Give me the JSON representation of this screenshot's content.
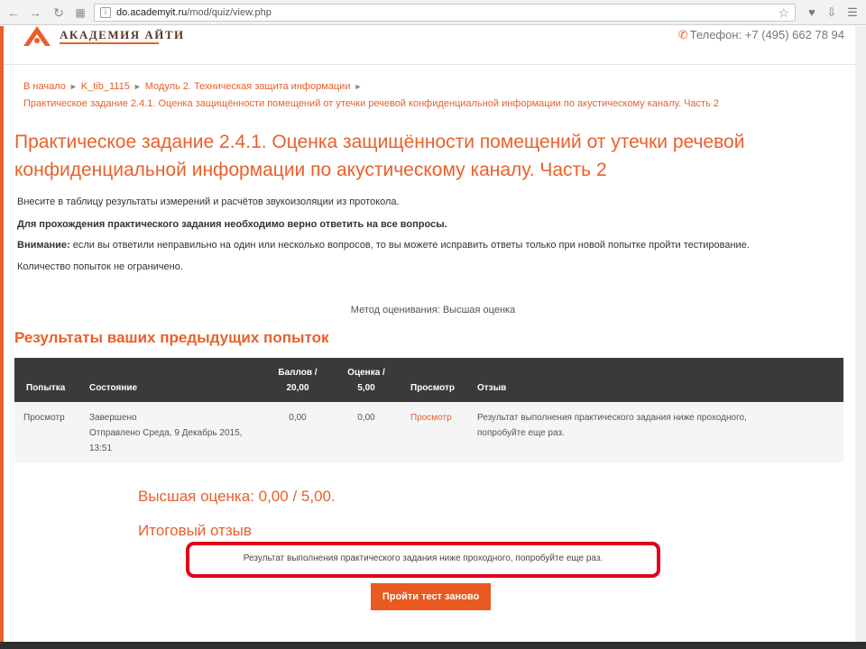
{
  "browser": {
    "url_host": "do.academyit.ru",
    "url_path": "/mod/quiz/view.php",
    "icons": [
      "back-icon",
      "forward-icon",
      "reload-icon",
      "apps-icon",
      "lock-icon",
      "star-icon",
      "heart-icon",
      "download-icon",
      "menu-icon"
    ]
  },
  "header": {
    "logo_text": "АКАДЕМИЯ АЙТИ",
    "phone": "Телефон: +7 (495) 662 78 94",
    "accent": "#e8602c"
  },
  "breadcrumb": {
    "items": [
      "В начало",
      "K_tib_1115",
      "Модуль 2. Техническая защита информации"
    ],
    "current": "Практическое задание 2.4.1. Оценка защищённости помещений от утечки речевой конфиденциальной информации по акустическому каналу. Часть 2"
  },
  "page": {
    "title": "Практическое задание 2.4.1. Оценка защищённости помещений от утечки речевой конфиденциальной информации по акустическому каналу. Часть 2",
    "intro_1": "Внесите в таблицу результаты измерений и расчётов звукоизоляции из протокола.",
    "intro_2": "Для прохождения практического задания необходимо верно ответить на все вопросы.",
    "intro_3_label": "Внимание:",
    "intro_3_text": " если вы ответили неправильно на один или несколько вопросов, то вы можете исправить ответы только при новой попытке пройти тестирование.",
    "intro_4": "Количество попыток не ограничено.",
    "grading_method": "Метод оценивания: Высшая оценка"
  },
  "results": {
    "section_title": "Результаты ваших предыдущих попыток",
    "columns": {
      "attempt": "Попытка",
      "state": "Состояние",
      "marks_1": "Баллов /",
      "marks_2": "20,00",
      "grade_1": "Оценка /",
      "grade_2": "5,00",
      "review": "Просмотр",
      "feedback": "Отзыв"
    },
    "rows": [
      {
        "attempt": "Просмотр",
        "state": "Завершено",
        "submitted_1": "Отправлено Среда, 9 Декабрь 2015,",
        "submitted_2": "13:51",
        "marks": "0,00",
        "grade": "0,00",
        "review": "Просмотр",
        "feedback_1": "Результат выполнения практического задания ниже проходного,",
        "feedback_2": "попробуйте еще раз."
      }
    ]
  },
  "summary": {
    "best_grade": "Высшая оценка: 0,00 / 5,00.",
    "final_feedback_title": "Итоговый отзыв",
    "final_feedback_text": "Результат выполнения практического задания ниже проходного, попробуйте еще раз.",
    "highlight_color": "#e0001a",
    "retry_button": "Пройти тест заново"
  }
}
